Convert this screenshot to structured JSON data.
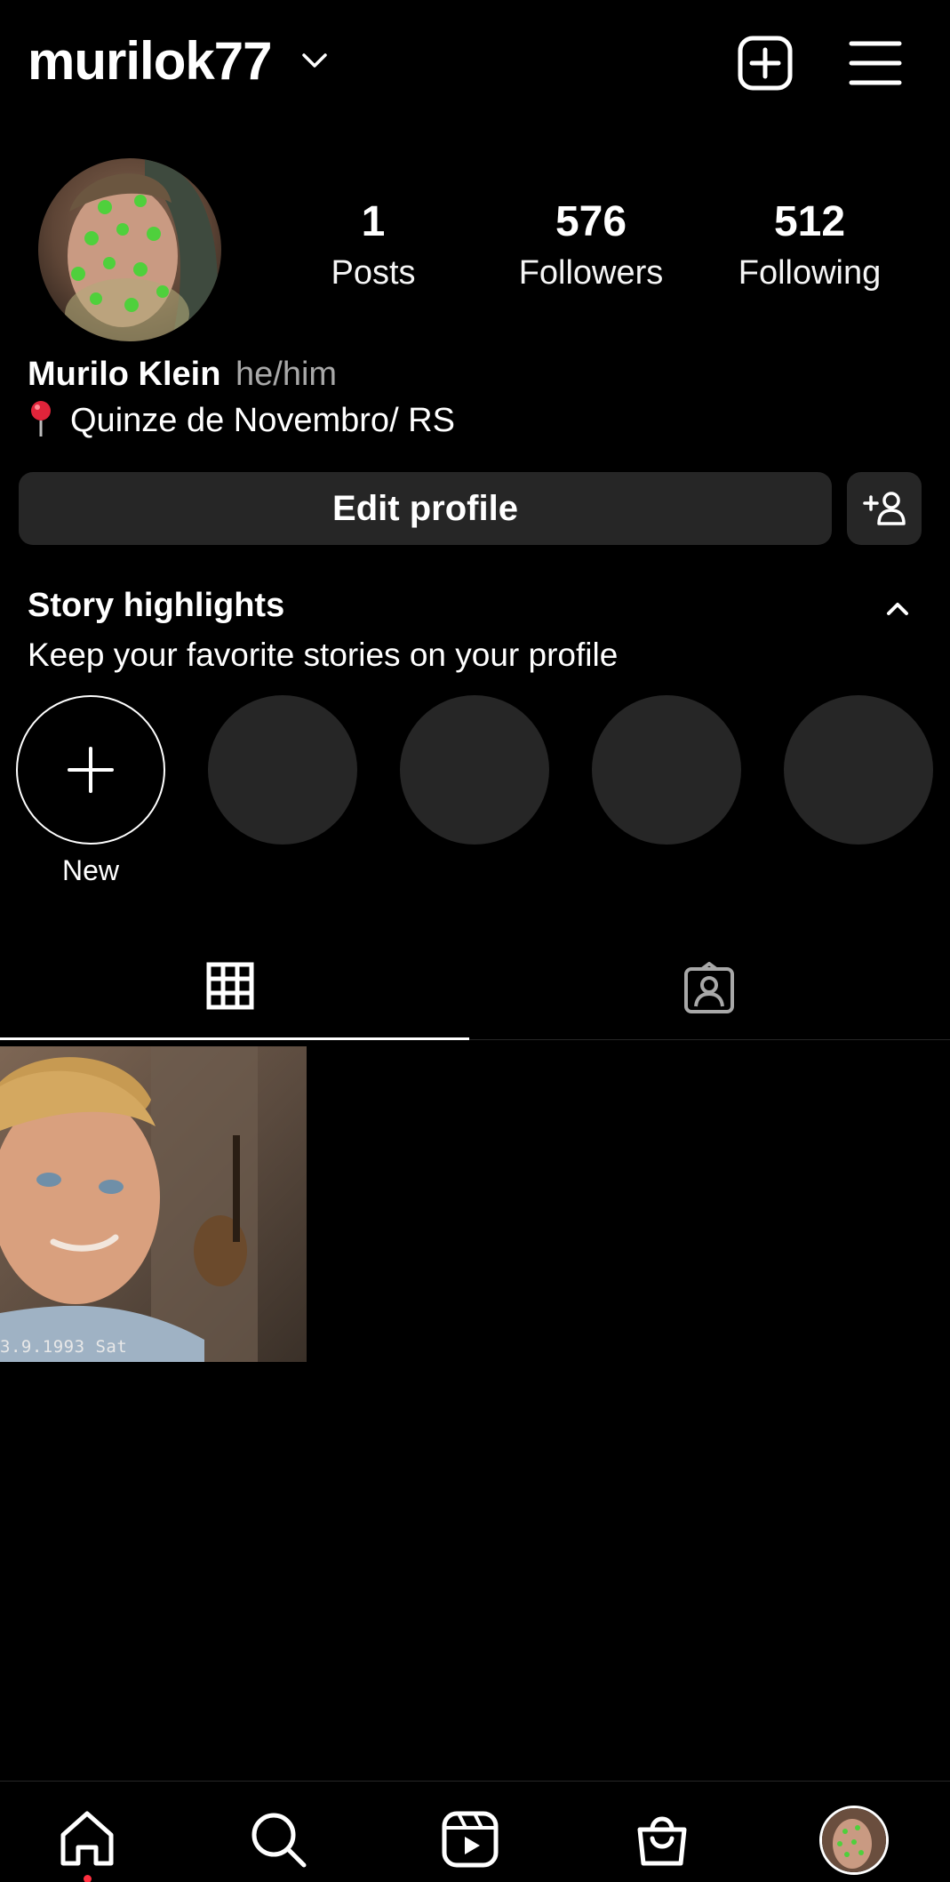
{
  "header": {
    "username": "murilok77",
    "icons": [
      "chevron-down-icon",
      "add-post-icon",
      "menu-icon"
    ]
  },
  "profile": {
    "stats": [
      {
        "value": "1",
        "label": "Posts"
      },
      {
        "value": "576",
        "label": "Followers"
      },
      {
        "value": "512",
        "label": "Following"
      }
    ],
    "full_name": "Murilo Klein",
    "pronouns": "he/him",
    "location": "Quinze de Novembro/ RS",
    "edit_label": "Edit profile"
  },
  "highlights": {
    "title": "Story highlights",
    "subtitle": "Keep your favorite stories on your profile",
    "new_label": "New"
  },
  "post": {
    "date_stamp": "3.9.1993 Sat"
  },
  "colors": {
    "background": "#000000",
    "button": "#262626",
    "secondary_text": "#a8a8a8",
    "notification_dot": "#ff3040"
  }
}
